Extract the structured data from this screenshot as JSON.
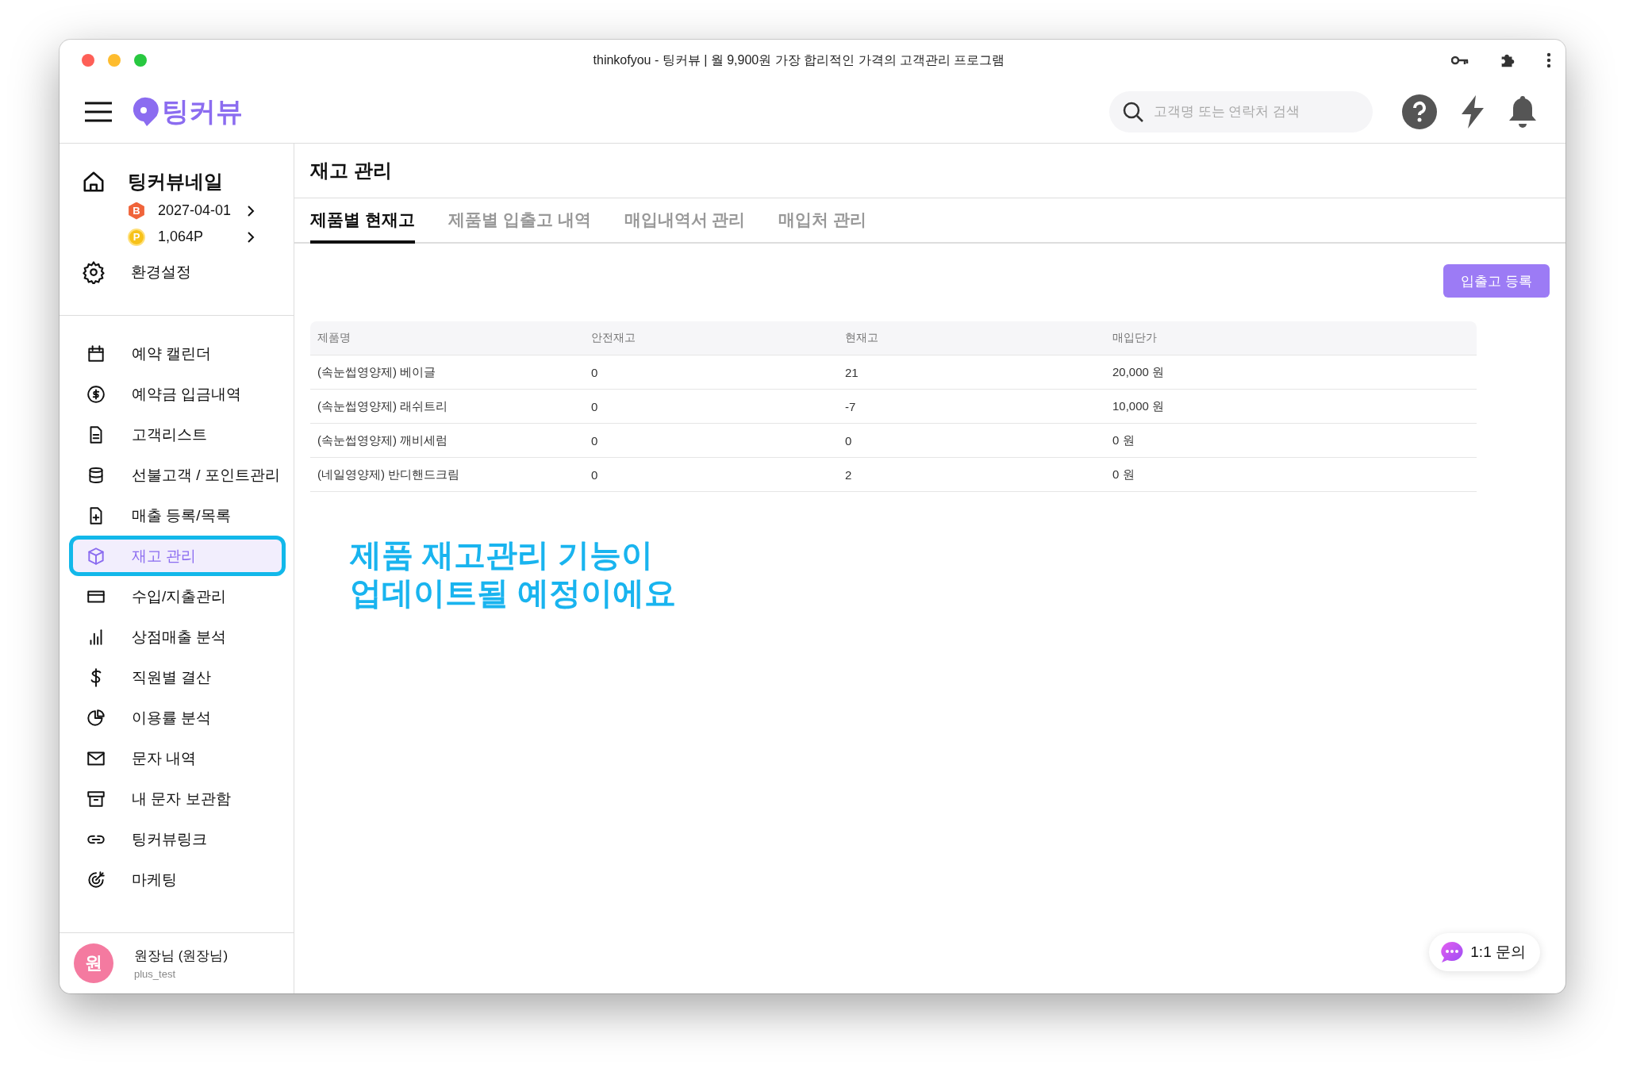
{
  "window": {
    "title": "thinkofyou - 팅커뷰 | 월 9,900원 가장 합리적인 가격의 고객관리 프로그램"
  },
  "header": {
    "logo": "팅커뷰",
    "search": {
      "placeholder": "고객명 또는 연락처 검색"
    }
  },
  "sidebar": {
    "shop": "팅커뷰네일",
    "badges": [
      {
        "mark": "B",
        "text": "2027-04-01"
      },
      {
        "mark": "P",
        "text": "1,064P"
      }
    ],
    "settings": "환경설정",
    "items": [
      {
        "label": "예약 캘린더",
        "selected": false
      },
      {
        "label": "예약금 입금내역",
        "selected": false
      },
      {
        "label": "고객리스트",
        "selected": false
      },
      {
        "label": "선불고객 / 포인트관리",
        "selected": false
      },
      {
        "label": "매출 등록/목록",
        "selected": false
      },
      {
        "label": "재고 관리",
        "selected": true
      },
      {
        "label": "수입/지출관리",
        "selected": false
      },
      {
        "label": "상점매출 분석",
        "selected": false
      },
      {
        "label": "직원별 결산",
        "selected": false
      },
      {
        "label": "이용률 분석",
        "selected": false
      },
      {
        "label": "문자 내역",
        "selected": false
      },
      {
        "label": "내 문자 보관함",
        "selected": false
      },
      {
        "label": "팅커뷰링크",
        "selected": false
      },
      {
        "label": "마케팅",
        "selected": false
      }
    ],
    "profile": {
      "avatar": "원",
      "name": "원장님 (원장님)",
      "id": "plus_test"
    }
  },
  "page": {
    "title": "재고 관리",
    "tabs": [
      {
        "label": "제품별 현재고",
        "selected": true
      },
      {
        "label": "제품별 입출고 내역",
        "selected": false
      },
      {
        "label": "매입내역서 관리",
        "selected": false
      },
      {
        "label": "매입처 관리",
        "selected": false
      }
    ],
    "button": "입출고 등록",
    "table": {
      "columns": [
        "제품명",
        "안전재고",
        "현재고",
        "매입단가"
      ],
      "rows": [
        [
          "(속눈썹영양제) 베이글",
          "0",
          "21",
          "20,000 원"
        ],
        [
          "(속눈썹영양제) 래쉬트리",
          "0",
          "-7",
          "10,000 원"
        ],
        [
          "(속눈썹영양제) 깨비세럼",
          "0",
          "0",
          "0 원"
        ],
        [
          "(네일영양제) 반디핸드크림",
          "0",
          "2",
          "0 원"
        ]
      ]
    },
    "notice": [
      "제품 재고관리 기능이",
      "업데이트될 예정이에요"
    ]
  },
  "chat": {
    "label": "1:1 문의"
  }
}
